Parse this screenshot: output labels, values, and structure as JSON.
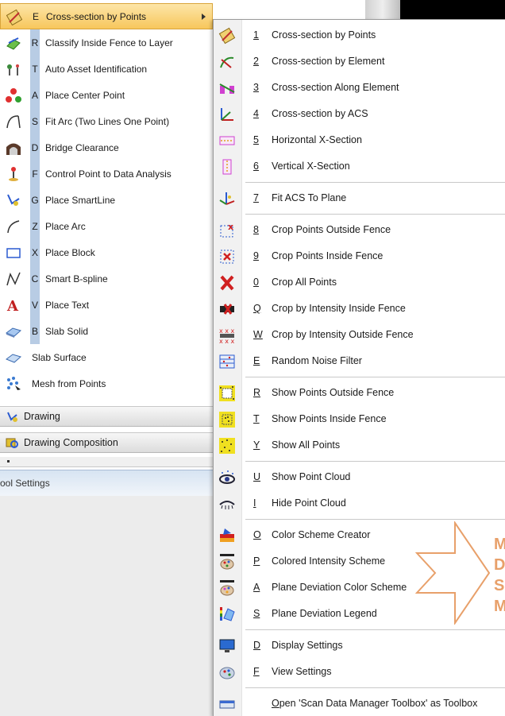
{
  "tools": [
    {
      "key": "E",
      "label": "Cross-section by Points",
      "icon": "cross-section-points-icon",
      "selected": true
    },
    {
      "key": "R",
      "label": "Classify Inside Fence to Layer",
      "icon": "classify-fence-icon"
    },
    {
      "key": "T",
      "label": "Auto Asset Identification",
      "icon": "asset-identification-icon"
    },
    {
      "key": "A",
      "label": "Place Center Point",
      "icon": "center-point-icon"
    },
    {
      "key": "S",
      "label": "Fit Arc (Two Lines One Point)",
      "icon": "fit-arc-icon"
    },
    {
      "key": "D",
      "label": "Bridge Clearance",
      "icon": "bridge-clearance-icon"
    },
    {
      "key": "F",
      "label": "Control Point to Data Analysis",
      "icon": "control-point-icon"
    },
    {
      "key": "G",
      "label": "Place SmartLine",
      "icon": "smartline-icon"
    },
    {
      "key": "Z",
      "label": "Place Arc",
      "icon": "place-arc-icon"
    },
    {
      "key": "X",
      "label": "Place Block",
      "icon": "place-block-icon"
    },
    {
      "key": "C",
      "label": "Smart B-spline",
      "icon": "bspline-icon"
    },
    {
      "key": "V",
      "label": "Place Text",
      "icon": "place-text-icon"
    },
    {
      "key": "B",
      "label": "Slab Solid",
      "icon": "slab-solid-icon"
    },
    {
      "key": "",
      "label": "Slab Surface",
      "icon": "slab-surface-icon"
    },
    {
      "key": "",
      "label": "Mesh from Points",
      "icon": "mesh-points-icon"
    }
  ],
  "sections": {
    "drawing": "Drawing",
    "drawing_composition": "Drawing Composition",
    "tool_settings": "ool Settings"
  },
  "menu": [
    {
      "key": "1",
      "label": "Cross-section by Points",
      "icon": "cross-section-points-icon"
    },
    {
      "key": "2",
      "label": "Cross-section by Element",
      "icon": "cross-section-element-icon"
    },
    {
      "key": "3",
      "label": "Cross-section Along Element",
      "icon": "cross-section-along-icon"
    },
    {
      "key": "4",
      "label": "Cross-section by ACS",
      "icon": "cross-section-acs-icon"
    },
    {
      "key": "5",
      "label": "Horizontal X-Section",
      "icon": "horizontal-xsection-icon"
    },
    {
      "key": "6",
      "label": "Vertical X-Section",
      "icon": "vertical-xsection-icon"
    },
    {
      "key": "7",
      "label": "Fit ACS To Plane",
      "icon": "fit-acs-icon"
    },
    {
      "key": "8",
      "label": "Crop Points Outside Fence",
      "icon": "crop-outside-icon"
    },
    {
      "key": "9",
      "label": "Crop Points Inside Fence",
      "icon": "crop-inside-icon"
    },
    {
      "key": "0",
      "label": "Crop All Points",
      "icon": "crop-all-icon"
    },
    {
      "key": "Q",
      "label": "Crop by Intensity Inside Fence",
      "icon": "crop-intensity-inside-icon"
    },
    {
      "key": "W",
      "label": "Crop by Intensity Outside Fence",
      "icon": "crop-intensity-outside-icon"
    },
    {
      "key": "E",
      "label": "Random Noise Filter",
      "icon": "noise-filter-icon"
    },
    {
      "key": "R",
      "label": "Show Points Outside Fence",
      "icon": "show-outside-icon"
    },
    {
      "key": "T",
      "label": "Show Points Inside Fence",
      "icon": "show-inside-icon"
    },
    {
      "key": "Y",
      "label": "Show All Points",
      "icon": "show-all-icon"
    },
    {
      "key": "U",
      "label": "Show Point Cloud",
      "icon": "show-cloud-icon"
    },
    {
      "key": "I",
      "label": "Hide Point Cloud",
      "icon": "hide-cloud-icon"
    },
    {
      "key": "O",
      "label": "Color Scheme Creator",
      "icon": "color-scheme-icon"
    },
    {
      "key": "P",
      "label": "Colored Intensity Scheme",
      "icon": "intensity-scheme-icon"
    },
    {
      "key": "A",
      "label": "Plane Deviation Color Scheme",
      "icon": "deviation-scheme-icon"
    },
    {
      "key": "S",
      "label": "Plane Deviation Legend",
      "icon": "deviation-legend-icon"
    },
    {
      "key": "D",
      "label": "Display Settings",
      "icon": "display-settings-icon"
    },
    {
      "key": "F",
      "label": "View Settings",
      "icon": "view-settings-icon"
    },
    {
      "key": "",
      "label": "Open 'Scan Data Manager Toolbox' as Toolbox",
      "label_underline": "O",
      "icon": "toolbox-icon"
    }
  ],
  "callout": {
    "lines": [
      "M",
      "D",
      "S",
      "M"
    ]
  },
  "colors": {
    "accent": "#f7c75c",
    "key_strip": "#b8cce4",
    "callout": "#e8a06a"
  }
}
